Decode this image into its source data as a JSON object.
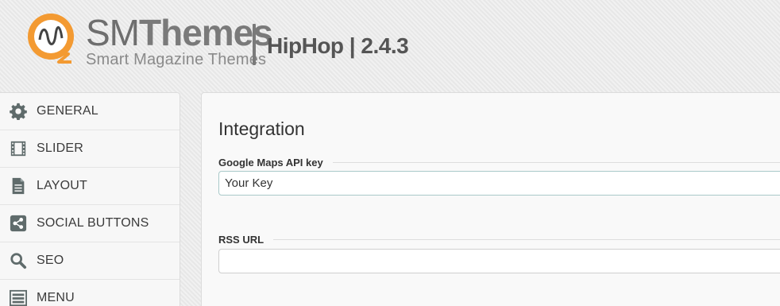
{
  "header": {
    "brand_name_part1": "SM",
    "brand_name_part2": "Themes",
    "brand_tagline": "Smart Magazine Themes",
    "theme_version": "HipHop | 2.4.3",
    "logo_icon": "smthemes-logo-icon",
    "logo_color": "#f39a32"
  },
  "sidebar": {
    "items": [
      {
        "label": "GENERAL",
        "icon": "gear-icon"
      },
      {
        "label": "SLIDER",
        "icon": "film-strip-icon"
      },
      {
        "label": "LAYOUT",
        "icon": "document-icon"
      },
      {
        "label": "SOCIAL BUTTONS",
        "icon": "share-icon"
      },
      {
        "label": "SEO",
        "icon": "search-icon"
      },
      {
        "label": "MENU",
        "icon": "menu-list-icon"
      }
    ]
  },
  "panel": {
    "title": "Integration",
    "fields": [
      {
        "label": "Google Maps API key",
        "value": "Your Key"
      },
      {
        "label": "RSS URL",
        "value": ""
      }
    ]
  },
  "colors": {
    "icon": "#5f6b6b",
    "accent": "#f39a32"
  }
}
